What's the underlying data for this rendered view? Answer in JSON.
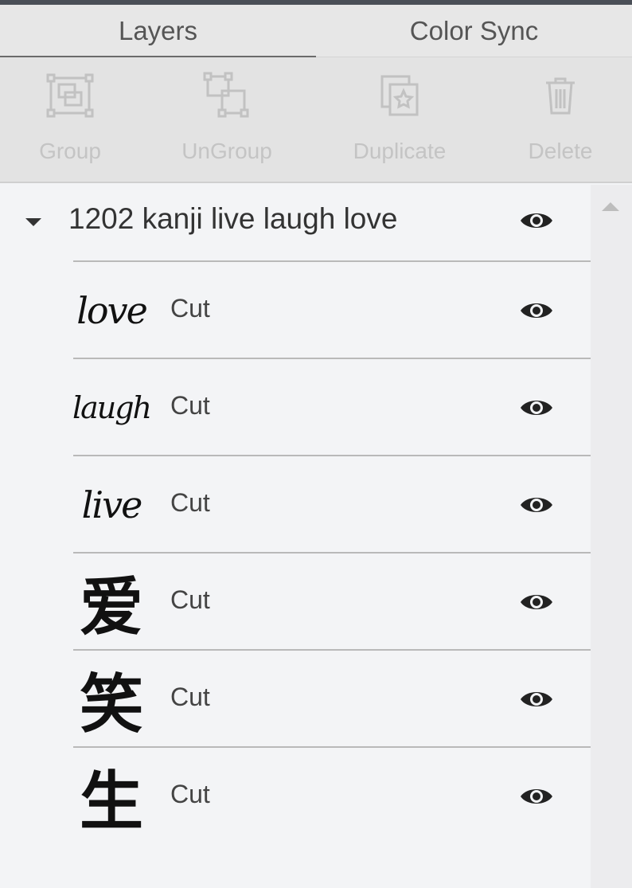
{
  "tabs": [
    {
      "label": "Layers",
      "active": true
    },
    {
      "label": "Color Sync",
      "active": false
    }
  ],
  "toolbar": [
    {
      "label": "Group",
      "icon": "group-icon",
      "enabled": false
    },
    {
      "label": "UnGroup",
      "icon": "ungroup-icon",
      "enabled": false
    },
    {
      "label": "Duplicate",
      "icon": "duplicate-icon",
      "enabled": false
    },
    {
      "label": "Delete",
      "icon": "trash-icon",
      "enabled": false
    }
  ],
  "group": {
    "name": "1202 kanji live laugh love",
    "expanded": true,
    "visible": true
  },
  "layers": [
    {
      "thumb": "love",
      "thumb_style": "script",
      "operation": "Cut",
      "visible": true
    },
    {
      "thumb": "laugh",
      "thumb_style": "script",
      "operation": "Cut",
      "visible": true
    },
    {
      "thumb": "live",
      "thumb_style": "script",
      "operation": "Cut",
      "visible": true
    },
    {
      "thumb": "爱",
      "thumb_style": "kanji",
      "operation": "Cut",
      "visible": true
    },
    {
      "thumb": "笑",
      "thumb_style": "kanji",
      "operation": "Cut",
      "visible": true
    },
    {
      "thumb": "生",
      "thumb_style": "kanji",
      "operation": "Cut",
      "visible": true
    }
  ]
}
